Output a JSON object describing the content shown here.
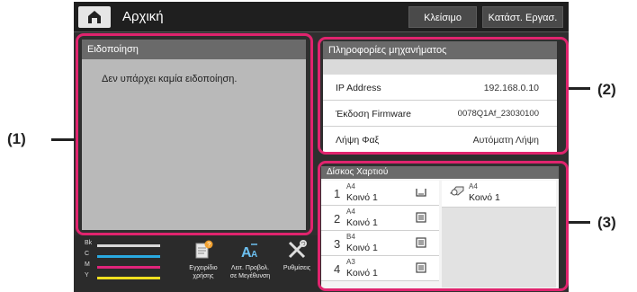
{
  "header": {
    "title": "Αρχική",
    "close_label": "Κλείσιμο",
    "job_status_label": "Κατάστ. Εργασ."
  },
  "notification": {
    "title": "Ειδοποίηση",
    "message": "Δεν υπάρχει καμία ειδοποίηση."
  },
  "machine_info": {
    "title": "Πληροφορίες μηχανήματος",
    "rows": [
      {
        "label": "IP Address",
        "value": "192.168.0.10"
      },
      {
        "label": "Έκδοση Firmware",
        "value": "0078Q1Af_23030100"
      },
      {
        "label": "Λήψη Φαξ",
        "value": "Αυτόματη Λήψη"
      }
    ]
  },
  "paper_tray": {
    "title": "Δίσκος Χαρτιού",
    "trays": [
      {
        "number": "1",
        "size": "A4",
        "type": "Κοινό 1",
        "icon": "tray-drawer-icon"
      },
      {
        "number": "2",
        "size": "A4",
        "type": "Κοινό 1",
        "icon": "tray-full-icon"
      },
      {
        "number": "3",
        "size": "B4",
        "type": "Κοινό 1",
        "icon": "tray-full-icon"
      },
      {
        "number": "4",
        "size": "A3",
        "type": "Κοινό 1",
        "icon": "tray-full-icon"
      }
    ],
    "bypass": {
      "size": "A4",
      "type": "Κοινό 1",
      "icon": "bypass-tray-icon"
    }
  },
  "toner": {
    "labels": [
      "Bk",
      "C",
      "M",
      "Y"
    ],
    "colors": [
      "#d8d8d8",
      "#29a9e0",
      "#e0247a",
      "#f0e020"
    ]
  },
  "bottom_tools": [
    {
      "label_line1": "Εγχειρίδιο",
      "label_line2": "χρήσης",
      "icon": "user-manual-icon"
    },
    {
      "label_line1": "Λειτ. Προβολ.",
      "label_line2": "σε Μεγέθυνση",
      "icon": "enlarge-display-icon"
    },
    {
      "label_line1": "Ρυθμίσεις",
      "label_line2": "",
      "icon": "settings-tools-icon"
    }
  ],
  "callouts": {
    "one": "(1)",
    "two": "(2)",
    "three": "(3)"
  },
  "colors": {
    "callout_frame": "#e0246e",
    "panel_header": "#6a6a6a",
    "screen_bg": "#2f2f2f"
  }
}
